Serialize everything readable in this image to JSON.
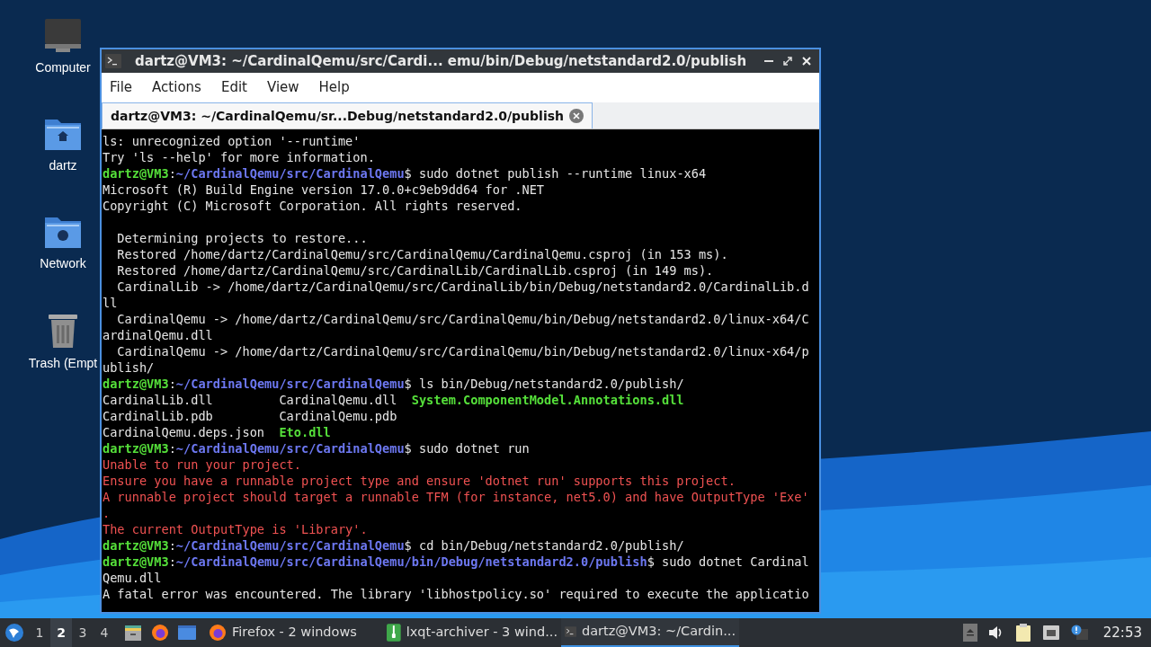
{
  "desktop_icons": [
    {
      "label": "Computer",
      "kind": "computer"
    },
    {
      "label": "dartz",
      "kind": "home"
    },
    {
      "label": "Network",
      "kind": "network"
    },
    {
      "label": "Trash (Empt",
      "kind": "trash"
    }
  ],
  "window": {
    "title": "dartz@VM3: ~/CardinalQemu/src/Cardi... emu/bin/Debug/netstandard2.0/publish",
    "menu": [
      "File",
      "Actions",
      "Edit",
      "View",
      "Help"
    ],
    "tabs": [
      {
        "label": "dartz@VM3: ~/CardinalQemu/sr...Debug/netstandard2.0/publish",
        "selected": true
      }
    ],
    "terminal_lines": [
      [
        {
          "text": "ls: unrecognized option '--runtime'",
          "kind": "plain"
        }
      ],
      [
        {
          "text": "Try 'ls --help' for more information.",
          "kind": "plain"
        }
      ],
      [
        {
          "text": "dartz@VM3",
          "kind": "user"
        },
        {
          "text": ":",
          "kind": "plain"
        },
        {
          "text": "~/CardinalQemu/src/CardinalQemu",
          "kind": "path"
        },
        {
          "text": "$ sudo dotnet publish --runtime linux-x64",
          "kind": "plain"
        }
      ],
      [
        {
          "text": "Microsoft (R) Build Engine version 17.0.0+c9eb9dd64 for .NET",
          "kind": "plain"
        }
      ],
      [
        {
          "text": "Copyright (C) Microsoft Corporation. All rights reserved.",
          "kind": "plain"
        }
      ],
      {
        "kind": "blank"
      },
      [
        {
          "text": "  Determining projects to restore...",
          "kind": "plain"
        }
      ],
      [
        {
          "text": "  Restored /home/dartz/CardinalQemu/src/CardinalQemu/CardinalQemu.csproj (in 153 ms).",
          "kind": "plain"
        }
      ],
      [
        {
          "text": "  Restored /home/dartz/CardinalQemu/src/CardinalLib/CardinalLib.csproj (in 149 ms).",
          "kind": "plain"
        }
      ],
      [
        {
          "text": "  CardinalLib -> /home/dartz/CardinalQemu/src/CardinalLib/bin/Debug/netstandard2.0/CardinalLib.d",
          "kind": "plain"
        }
      ],
      [
        {
          "text": "ll",
          "kind": "plain"
        }
      ],
      [
        {
          "text": "  CardinalQemu -> /home/dartz/CardinalQemu/src/CardinalQemu/bin/Debug/netstandard2.0/linux-x64/C",
          "kind": "plain"
        }
      ],
      [
        {
          "text": "ardinalQemu.dll",
          "kind": "plain"
        }
      ],
      [
        {
          "text": "  CardinalQemu -> /home/dartz/CardinalQemu/src/CardinalQemu/bin/Debug/netstandard2.0/linux-x64/p",
          "kind": "plain"
        }
      ],
      [
        {
          "text": "ublish/",
          "kind": "plain"
        }
      ],
      [
        {
          "text": "dartz@VM3",
          "kind": "user"
        },
        {
          "text": ":",
          "kind": "plain"
        },
        {
          "text": "~/CardinalQemu/src/CardinalQemu",
          "kind": "path"
        },
        {
          "text": "$ ls bin/Debug/netstandard2.0/publish/",
          "kind": "plain"
        }
      ],
      [
        {
          "text": "CardinalLib.dll         CardinalQemu.dll  ",
          "kind": "plain"
        },
        {
          "text": "System.ComponentModel.Annotations.dll",
          "kind": "exec"
        }
      ],
      [
        {
          "text": "CardinalLib.pdb         CardinalQemu.pdb",
          "kind": "plain"
        }
      ],
      [
        {
          "text": "CardinalQemu.deps.json  ",
          "kind": "plain"
        },
        {
          "text": "Eto.dll",
          "kind": "exec"
        }
      ],
      [
        {
          "text": "dartz@VM3",
          "kind": "user"
        },
        {
          "text": ":",
          "kind": "plain"
        },
        {
          "text": "~/CardinalQemu/src/CardinalQemu",
          "kind": "path"
        },
        {
          "text": "$ sudo dotnet run",
          "kind": "plain"
        }
      ],
      [
        {
          "text": "Unable to run your project.",
          "kind": "error"
        }
      ],
      [
        {
          "text": "Ensure you have a runnable project type and ensure 'dotnet run' supports this project.",
          "kind": "error"
        }
      ],
      [
        {
          "text": "A runnable project should target a runnable TFM (for instance, net5.0) and have OutputType 'Exe'",
          "kind": "error"
        }
      ],
      [
        {
          "text": ".",
          "kind": "error"
        }
      ],
      [
        {
          "text": "The current OutputType is 'Library'.",
          "kind": "error"
        }
      ],
      [
        {
          "text": "dartz@VM3",
          "kind": "user"
        },
        {
          "text": ":",
          "kind": "plain"
        },
        {
          "text": "~/CardinalQemu/src/CardinalQemu",
          "kind": "path"
        },
        {
          "text": "$ cd bin/Debug/netstandard2.0/publish/",
          "kind": "plain"
        }
      ],
      [
        {
          "text": "dartz@VM3",
          "kind": "user"
        },
        {
          "text": ":",
          "kind": "plain"
        },
        {
          "text": "~/CardinalQemu/src/CardinalQemu/bin/Debug/netstandard2.0/publish",
          "kind": "path"
        },
        {
          "text": "$ sudo dotnet Cardinal",
          "kind": "plain"
        }
      ],
      [
        {
          "text": "Qemu.dll",
          "kind": "plain"
        }
      ],
      [
        {
          "text": "A fatal error was encountered. The library 'libhostpolicy.so' required to execute the applicatio",
          "kind": "plain"
        }
      ]
    ]
  },
  "taskbar": {
    "desktops": [
      {
        "label": "1",
        "selected": false
      },
      {
        "label": "2",
        "selected": true
      },
      {
        "label": "3",
        "selected": false
      },
      {
        "label": "4",
        "selected": false
      }
    ],
    "quick_launch": [
      {
        "kind": "files"
      },
      {
        "kind": "firefox"
      },
      {
        "kind": "window"
      }
    ],
    "tasks": [
      {
        "label": "Firefox - 2 windows",
        "kind": "firefox",
        "selected": false
      },
      {
        "label": "lxqt-archiver - 3 wind...",
        "kind": "archiver",
        "selected": false
      },
      {
        "label": "dartz@VM3: ~/Cardin...",
        "kind": "terminal",
        "selected": true
      }
    ],
    "clock": "22:53"
  }
}
